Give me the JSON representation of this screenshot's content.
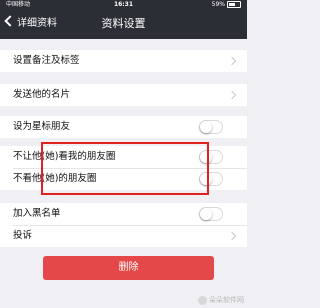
{
  "status_bar": {
    "carrier": "中国移动",
    "time": "16:31",
    "battery": "59%"
  },
  "nav": {
    "back_label": "详细资料",
    "title": "资料设置"
  },
  "group1": {
    "remark_label": "设置备注及标签"
  },
  "group2": {
    "send_card_label": "发送他的名片"
  },
  "group3": {
    "star_label": "设为星标朋友",
    "star_on": false
  },
  "group4": {
    "hide_my_moments_label": "不让他(她)看我的朋友圈",
    "hide_their_moments_label": "不看他(她)的朋友圈",
    "hide_my_on": false,
    "hide_their_on": false
  },
  "group5": {
    "blacklist_label": "加入黑名单",
    "blacklist_on": false,
    "report_label": "投诉"
  },
  "delete_button": {
    "label": "删除",
    "color": "#e54848"
  },
  "watermark": {
    "text": "朵朵软件网"
  }
}
